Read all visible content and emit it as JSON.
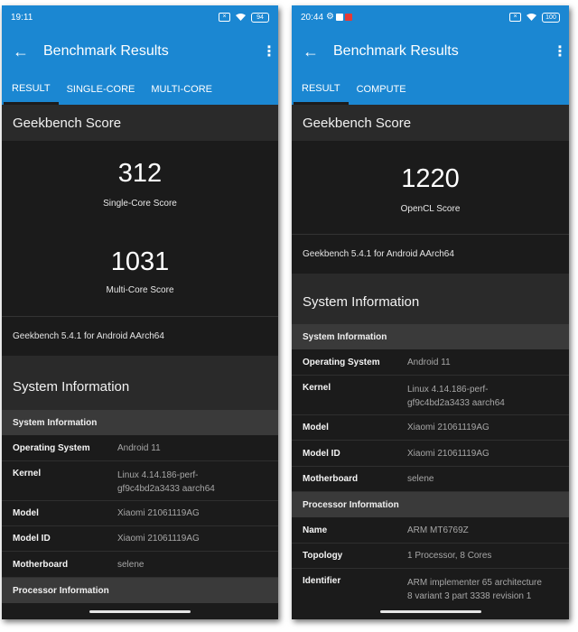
{
  "left": {
    "status": {
      "time": "19:11",
      "battery": "94"
    },
    "appbar": {
      "title": "Benchmark Results"
    },
    "tabs": [
      "RESULT",
      "SINGLE-CORE",
      "MULTI-CORE"
    ],
    "geekbench_title": "Geekbench Score",
    "single_core": {
      "score": "312",
      "label": "Single-Core Score"
    },
    "multi_core": {
      "score": "1031",
      "label": "Multi-Core Score"
    },
    "version": "Geekbench 5.4.1 for Android AArch64",
    "system_title": "System Information",
    "system_subheader": "System Information",
    "rows": [
      {
        "label": "Operating System",
        "value": "Android 11"
      },
      {
        "label": "Kernel",
        "value": "Linux 4.14.186-perf-",
        "value2": "gf9c4bd2a3433 aarch64"
      },
      {
        "label": "Model",
        "value": "Xiaomi 21061119AG"
      },
      {
        "label": "Model ID",
        "value": "Xiaomi 21061119AG"
      },
      {
        "label": "Motherboard",
        "value": "selene"
      }
    ],
    "processor_subheader": "Processor Information"
  },
  "right": {
    "status": {
      "time": "20:44",
      "battery": "100"
    },
    "appbar": {
      "title": "Benchmark Results"
    },
    "tabs": [
      "RESULT",
      "COMPUTE"
    ],
    "geekbench_title": "Geekbench Score",
    "opencl": {
      "score": "1220",
      "label": "OpenCL Score"
    },
    "version": "Geekbench 5.4.1 for Android AArch64",
    "system_title": "System Information",
    "system_subheader": "System Information",
    "rows": [
      {
        "label": "Operating System",
        "value": "Android 11"
      },
      {
        "label": "Kernel",
        "value": "Linux 4.14.186-perf-",
        "value2": "gf9c4bd2a3433 aarch64"
      },
      {
        "label": "Model",
        "value": "Xiaomi 21061119AG"
      },
      {
        "label": "Model ID",
        "value": "Xiaomi 21061119AG"
      },
      {
        "label": "Motherboard",
        "value": "selene"
      }
    ],
    "processor_subheader": "Processor Information",
    "processor_rows": [
      {
        "label": "Name",
        "value": "ARM MT6769Z"
      },
      {
        "label": "Topology",
        "value": "1 Processor, 8 Cores"
      },
      {
        "label": "Identifier",
        "value": "ARM implementer 65 architecture",
        "value2": "8 variant 3 part 3338 revision 1"
      }
    ]
  }
}
